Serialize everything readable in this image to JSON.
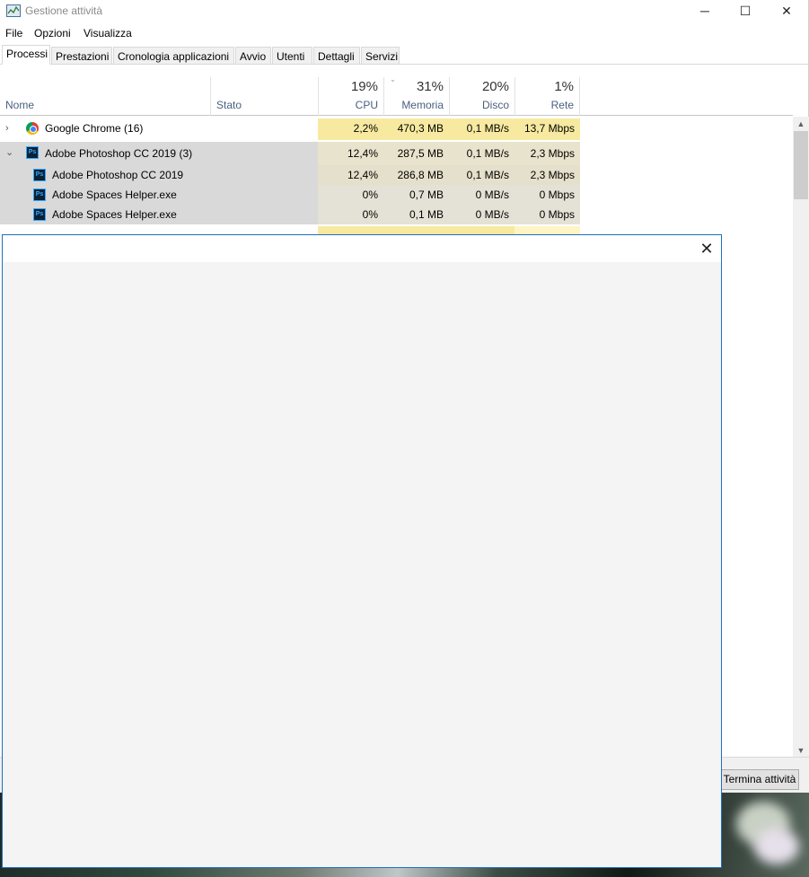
{
  "window": {
    "title": "Gestione attività",
    "minimize_glyph": "─",
    "maximize_glyph": "☐",
    "close_glyph": "✕"
  },
  "menu": [
    "File",
    "Opzioni",
    "Visualizza"
  ],
  "tabs": [
    {
      "label": "Processi",
      "active": true
    },
    {
      "label": "Prestazioni",
      "active": false
    },
    {
      "label": "Cronologia applicazioni",
      "active": false
    },
    {
      "label": "Avvio",
      "active": false
    },
    {
      "label": "Utenti",
      "active": false
    },
    {
      "label": "Dettagli",
      "active": false
    },
    {
      "label": "Servizi",
      "active": false
    }
  ],
  "columns": {
    "name": "Nome",
    "status": "Stato",
    "cpu": {
      "percent": "19%",
      "label": "CPU"
    },
    "memory": {
      "percent": "31%",
      "label": "Memoria",
      "sort_caret": "ˇ"
    },
    "disk": {
      "percent": "20%",
      "label": "Disco"
    },
    "network": {
      "percent": "1%",
      "label": "Rete"
    }
  },
  "processes": [
    {
      "expander": "›",
      "icon": "chrome-icon",
      "name": "Google Chrome (16)",
      "cpu": "2,2%",
      "memory": "470,3 MB",
      "disk": "0,1 MB/s",
      "network": "13,7 Mbps"
    },
    {
      "expander": "⌄",
      "icon": "photoshop-icon",
      "name": "Adobe Photoshop CC 2019 (3)",
      "cpu": "12,4%",
      "memory": "287,5 MB",
      "disk": "0,1 MB/s",
      "network": "2,3 Mbps"
    },
    {
      "sub": true,
      "icon": "photoshop-icon",
      "name": "Adobe Photoshop CC 2019",
      "cpu": "12,4%",
      "memory": "286,8 MB",
      "disk": "0,1 MB/s",
      "network": "2,3 Mbps"
    },
    {
      "sub": true,
      "icon": "photoshop-icon",
      "name": "Adobe Spaces Helper.exe",
      "cpu": "0%",
      "memory": "0,7 MB",
      "disk": "0 MB/s",
      "network": "0 Mbps"
    },
    {
      "sub": true,
      "icon": "photoshop-icon",
      "name": "Adobe Spaces Helper.exe",
      "cpu": "0%",
      "memory": "0,1 MB",
      "disk": "0 MB/s",
      "network": "0 Mbps"
    }
  ],
  "end_task_label": "Termina attività",
  "ps_icon_text": "Ps",
  "overlay": {
    "close_glyph": "✕"
  },
  "colors": {
    "heat_high": "#f7eaa0",
    "heat_low": "#fff4c4",
    "group_gray": "#d9d9d9",
    "accent": "#1f6fbf"
  }
}
